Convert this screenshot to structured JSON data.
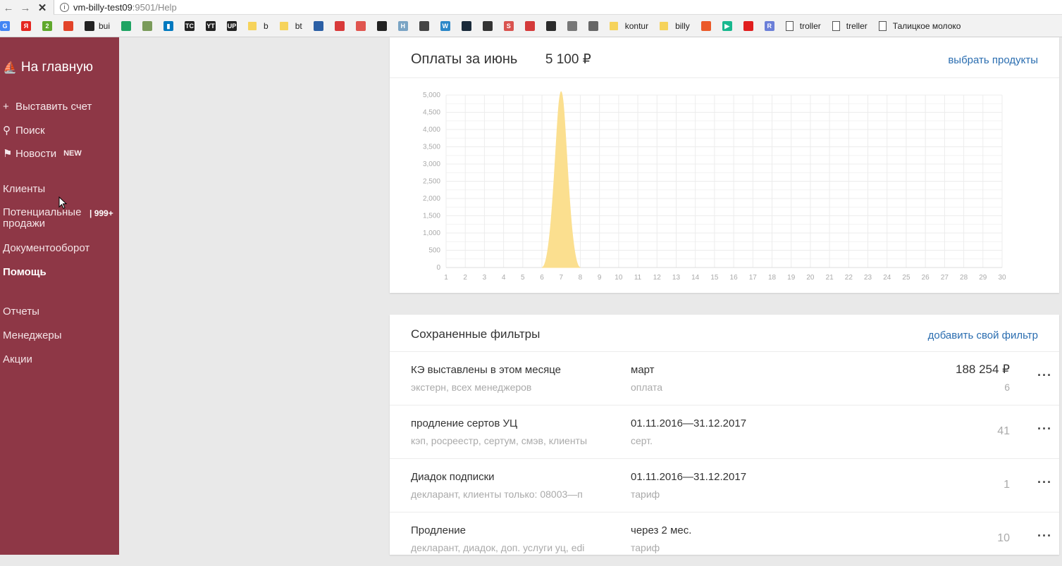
{
  "browser": {
    "url_host": "vm-billy-test09",
    "url_path": ":9501/Help",
    "bookmarks": [
      {
        "icon": "google-icon",
        "label": "",
        "color": "#4285f4"
      },
      {
        "icon": "yandex-icon",
        "label": "",
        "color": "#e52620"
      },
      {
        "icon": "bookmark-2-icon",
        "label": "",
        "color": "#5fa82c"
      },
      {
        "icon": "gitlab-icon",
        "label": "",
        "color": "#e24329"
      },
      {
        "icon": "github-icon",
        "label": "bui",
        "color": "#222222"
      },
      {
        "icon": "drive-icon",
        "label": "",
        "color": "#1fa463"
      },
      {
        "icon": "image-icon",
        "label": "",
        "color": "#7a9b5a"
      },
      {
        "icon": "trello-icon",
        "label": "",
        "color": "#0079bf"
      },
      {
        "icon": "teamcity-icon",
        "label": "",
        "color": "#222222"
      },
      {
        "icon": "youtrack-icon",
        "label": "",
        "color": "#222222"
      },
      {
        "icon": "upsource-icon",
        "label": "",
        "color": "#222222"
      },
      {
        "icon": "folder-icon",
        "label": "b",
        "color": "#f6d35b"
      },
      {
        "icon": "folder-icon",
        "label": "bt",
        "color": "#f6d35b"
      },
      {
        "icon": "tools-icon",
        "label": "",
        "color": "#2b5fa5"
      },
      {
        "icon": "user-icon",
        "label": "",
        "color": "#d83a3a"
      },
      {
        "icon": "circle-icon",
        "label": "",
        "color": "#e0554f"
      },
      {
        "icon": "github-icon",
        "label": "",
        "color": "#222222"
      },
      {
        "icon": "h-icon",
        "label": "",
        "color": "#7aa4c4"
      },
      {
        "icon": "panda-icon",
        "label": "",
        "color": "#444444"
      },
      {
        "icon": "wordpress-icon",
        "label": "",
        "color": "#2a86c8"
      },
      {
        "icon": "star-dark-icon",
        "label": "",
        "color": "#1a2a3a"
      },
      {
        "icon": "network-icon",
        "label": "",
        "color": "#333333"
      },
      {
        "icon": "s-icon",
        "label": "",
        "color": "#d9534f"
      },
      {
        "icon": "badge-icon",
        "label": "",
        "color": "#d43a3a"
      },
      {
        "icon": "doc-dark-icon",
        "label": "",
        "color": "#2b2b2b"
      },
      {
        "icon": "cloud-icon",
        "label": "",
        "color": "#777777"
      },
      {
        "icon": "grid-icon",
        "label": "",
        "color": "#666666"
      },
      {
        "icon": "folder-icon",
        "label": "kontur",
        "color": "#f6d35b"
      },
      {
        "icon": "folder-icon",
        "label": "billy",
        "color": "#f6d35b"
      },
      {
        "icon": "office-icon",
        "label": "",
        "color": "#eb5a2a"
      },
      {
        "icon": "play-icon",
        "label": "",
        "color": "#18b88e"
      },
      {
        "icon": "home-red-icon",
        "label": "",
        "color": "#e01e1e"
      },
      {
        "icon": "r-icon",
        "label": "",
        "color": "#6b7fd8"
      },
      {
        "icon": "page-icon",
        "label": "troller",
        "color": "#ffffff"
      },
      {
        "icon": "page-icon",
        "label": "treller",
        "color": "#ffffff"
      },
      {
        "icon": "page-icon",
        "label": "Талицкое молоко",
        "color": "#ffffff"
      }
    ]
  },
  "sidebar": {
    "home": "На главную",
    "actions": [
      {
        "icon": "plus-icon",
        "glyph": "+",
        "label": "Выставить счет"
      },
      {
        "icon": "search-icon",
        "glyph": "⚲",
        "label": "Поиск"
      },
      {
        "icon": "flag-icon",
        "glyph": "⚑",
        "label": "Новости",
        "badge": "NEW"
      }
    ],
    "nav": [
      {
        "label": "Клиенты"
      },
      {
        "label": "Потенциальные продажи",
        "line1": "Потенциальные",
        "line2": "продажи",
        "badge": "| 999+"
      },
      {
        "label": "Документооборот"
      },
      {
        "label": "Помощь",
        "active": true
      },
      {
        "label": "Отчеты"
      },
      {
        "label": "Менеджеры"
      },
      {
        "label": "Акции"
      }
    ],
    "colors": {
      "background": "#8e3746",
      "text": "#ffffff"
    }
  },
  "payments": {
    "title": "Оплаты за июнь",
    "amount": "5 100 ₽",
    "select_link": "выбрать продукты"
  },
  "chart_data": {
    "type": "area",
    "title": "",
    "xlabel": "",
    "ylabel": "",
    "x": [
      1,
      2,
      3,
      4,
      5,
      6,
      7,
      8,
      9,
      10,
      11,
      12,
      13,
      14,
      15,
      16,
      17,
      18,
      19,
      20,
      21,
      22,
      23,
      24,
      25,
      26,
      27,
      28,
      29,
      30
    ],
    "values": [
      0,
      0,
      0,
      0,
      0,
      0,
      5100,
      0,
      0,
      0,
      0,
      0,
      0,
      0,
      0,
      0,
      0,
      0,
      0,
      0,
      0,
      0,
      0,
      0,
      0,
      0,
      0,
      0,
      0,
      0
    ],
    "y_ticks": [
      "0",
      "500",
      "1,000",
      "1,500",
      "2,000",
      "2,500",
      "3,000",
      "3,500",
      "4,000",
      "4,500",
      "5,000"
    ],
    "ylim": [
      0,
      5000
    ],
    "grid": true,
    "color": "#fbdf8f"
  },
  "filters": {
    "title": "Сохраненные фильтры",
    "add_link": "добавить свой фильтр",
    "rows": [
      {
        "name": "КЭ выставлены в этом месяце",
        "desc": "экстерн, всех менеджеров",
        "period": "март",
        "type": "оплата",
        "amount": "188 254 ₽",
        "count": "6"
      },
      {
        "name": "продление сертов УЦ",
        "desc": "кэп, росреестр, сертум, смэв, клиенты",
        "period": "01.11.2016—31.12.2017",
        "type": "серт.",
        "amount": "",
        "count": "41"
      },
      {
        "name": "Диадок подписки",
        "desc": "декларант, клиенты только: 08003—п",
        "period": "01.11.2016—31.12.2017",
        "type": "тариф",
        "amount": "",
        "count": "1"
      },
      {
        "name": "Продление",
        "desc": "декларант, диадок, доп. услуги уц, edi",
        "period": "через 2 мес.",
        "type": "тариф",
        "amount": "",
        "count": "10"
      }
    ],
    "more_glyph": "···"
  }
}
